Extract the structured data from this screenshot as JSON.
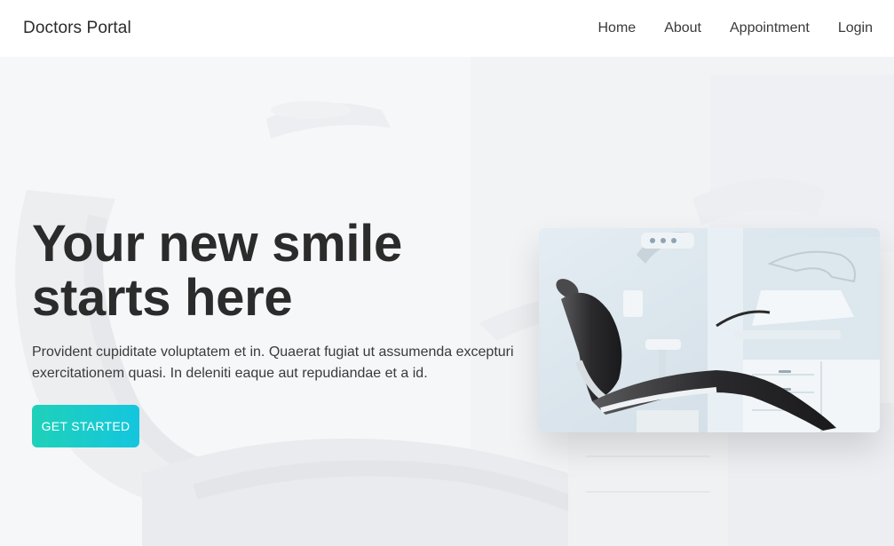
{
  "navbar": {
    "brand": "Doctors Portal",
    "links": [
      {
        "label": "Home"
      },
      {
        "label": "About"
      },
      {
        "label": "Appointment"
      },
      {
        "label": "Login"
      }
    ]
  },
  "hero": {
    "title_line1": "Your new smile",
    "title_line2": "starts here",
    "description": "Provident cupiditate voluptatem et in. Quaerat fugiat ut assumenda excepturi exercitationem quasi. In deleniti eaque aut repudiandae et a id.",
    "cta_label": "GET STARTED",
    "image_alt": "Dental chair in a clinic"
  },
  "colors": {
    "accent_start": "#1fd1b8",
    "accent_end": "#14c6de",
    "text_dark": "#2b2b2b",
    "navbar_bg": "#ffffff"
  }
}
